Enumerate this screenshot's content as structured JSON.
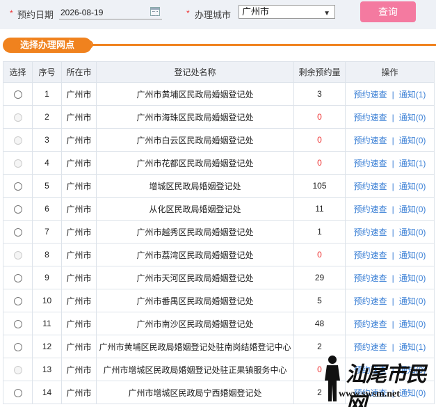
{
  "search": {
    "date_label": "预约日期",
    "date_value": "2026-08-19",
    "city_label": "办理城市",
    "city_value": "广州市",
    "query_label": "查询"
  },
  "section": {
    "title": "选择办理网点"
  },
  "table": {
    "headers": [
      "选择",
      "序号",
      "所在市",
      "登记处名称",
      "剩余预约量",
      "操作"
    ],
    "action_label": "预约速查",
    "rows": [
      {
        "no": "1",
        "city": "广州市",
        "name": "广州市黄埔区民政局婚姻登记处",
        "remain": "3",
        "notice": "通知(1)",
        "enabled": true
      },
      {
        "no": "2",
        "city": "广州市",
        "name": "广州市海珠区民政局婚姻登记处",
        "remain": "0",
        "notice": "通知(0)",
        "enabled": false
      },
      {
        "no": "3",
        "city": "广州市",
        "name": "广州市白云区民政局婚姻登记处",
        "remain": "0",
        "notice": "通知(0)",
        "enabled": false
      },
      {
        "no": "4",
        "city": "广州市",
        "name": "广州市花都区民政局婚姻登记处",
        "remain": "0",
        "notice": "通知(1)",
        "enabled": false
      },
      {
        "no": "5",
        "city": "广州市",
        "name": "增城区民政局婚姻登记处",
        "remain": "105",
        "notice": "通知(0)",
        "enabled": true
      },
      {
        "no": "6",
        "city": "广州市",
        "name": "从化区民政局婚姻登记处",
        "remain": "11",
        "notice": "通知(0)",
        "enabled": true
      },
      {
        "no": "7",
        "city": "广州市",
        "name": "广州市越秀区民政局婚姻登记处",
        "remain": "1",
        "notice": "通知(0)",
        "enabled": true
      },
      {
        "no": "8",
        "city": "广州市",
        "name": "广州市荔湾区民政局婚姻登记处",
        "remain": "0",
        "notice": "通知(0)",
        "enabled": false
      },
      {
        "no": "9",
        "city": "广州市",
        "name": "广州市天河区民政局婚姻登记处",
        "remain": "29",
        "notice": "通知(0)",
        "enabled": true
      },
      {
        "no": "10",
        "city": "广州市",
        "name": "广州市番禺区民政局婚姻登记处",
        "remain": "5",
        "notice": "通知(0)",
        "enabled": true
      },
      {
        "no": "11",
        "city": "广州市",
        "name": "广州市南沙区民政局婚姻登记处",
        "remain": "48",
        "notice": "通知(0)",
        "enabled": true
      },
      {
        "no": "12",
        "city": "广州市",
        "name": "广州市黄埔区民政局婚姻登记处驻南岗结婚登记中心",
        "remain": "2",
        "notice": "通知(1)",
        "enabled": true
      },
      {
        "no": "13",
        "city": "广州市",
        "name": "广州市增城区民政局婚姻登记处驻正果镇服务中心",
        "remain": "0",
        "notice": "通知(0)",
        "enabled": false
      },
      {
        "no": "14",
        "city": "广州市",
        "name": "广州市增城区民政局宁西婚姻登记处",
        "remain": "2",
        "notice": "通知(0)",
        "enabled": true
      }
    ]
  },
  "watermark": {
    "title": "汕尾市民网",
    "url": "www.swsm.net"
  },
  "colors": {
    "accent": "#f0821e",
    "button": "#f47aa0",
    "link": "#3a7fd5",
    "available": "#2a8a2a",
    "unavailable": "#e33333"
  }
}
